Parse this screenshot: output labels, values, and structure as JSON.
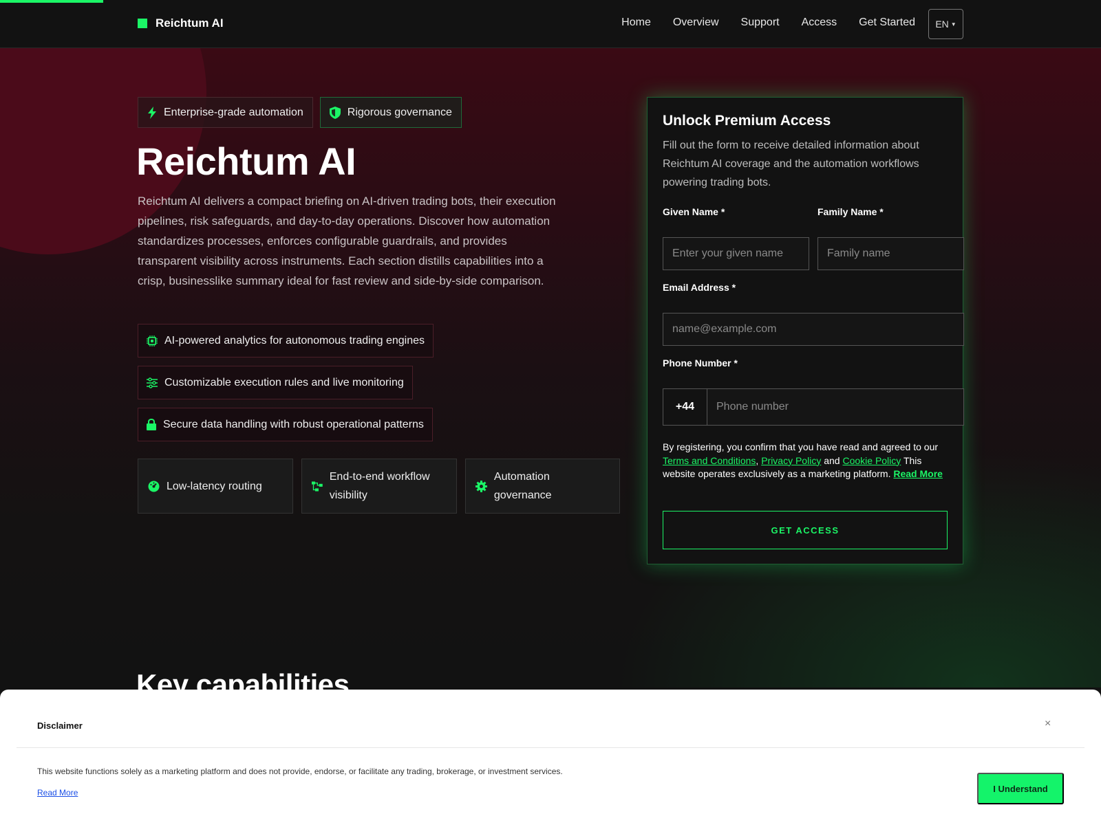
{
  "nav": {
    "brand": "Reichtum AI",
    "links": [
      "Home",
      "Overview",
      "Support",
      "Access",
      "Get Started"
    ],
    "language": "EN"
  },
  "hero": {
    "badges": [
      "Enterprise-grade automation",
      "Rigorous governance"
    ],
    "title": "Reichtum AI",
    "description": "Reichtum AI delivers a compact briefing on AI-driven trading bots, their execution pipelines, risk safeguards, and day-to-day operations. Discover how automation standardizes processes, enforces configurable guardrails, and provides transparent visibility across instruments. Each section distills capabilities into a crisp, businesslike summary ideal for fast review and side-by-side comparison.",
    "features": [
      {
        "label": "AI-powered analytics for autonomous trading engines",
        "icon": "chip-icon"
      },
      {
        "label": "Customizable execution rules and live monitoring",
        "icon": "sliders-icon"
      },
      {
        "label": "Secure data handling with robust operational patterns",
        "icon": "lock-icon"
      }
    ],
    "cards": [
      {
        "label": "Low-latency routing",
        "icon": "gauge-icon"
      },
      {
        "label": "End-to-end workflow visibility",
        "icon": "workflow-icon"
      },
      {
        "label": "Automation governance",
        "icon": "gear-icon"
      }
    ]
  },
  "form": {
    "title": "Unlock Premium Access",
    "subtitle": "Fill out the form to receive detailed information about Reichtum AI coverage and the automation workflows powering trading bots.",
    "given_name_label": "Given Name *",
    "given_name_placeholder": "Enter your given name",
    "family_name_label": "Family Name *",
    "family_name_placeholder": "Family name",
    "email_label": "Email Address *",
    "email_placeholder": "name@example.com",
    "phone_label": "Phone Number *",
    "phone_code": "+44",
    "phone_placeholder": "Phone number",
    "terms_prefix": "By registering, you confirm that you have read and agreed to our",
    "terms_link": "Terms and Conditions",
    "privacy_link": "Privacy Policy",
    "and": "and",
    "cookie_link": "Cookie Policy",
    "terms_suffix": "This website operates exclusively as a marketing platform.",
    "read_more": "Read More",
    "submit_label": "GET ACCESS"
  },
  "section": {
    "heading": "Key capabilities"
  },
  "disclaimer": {
    "title": "Disclaimer",
    "close": "×",
    "text": "This website functions solely as a marketing platform and does not provide, endorse, or facilitate any trading, brokerage, or investment services.",
    "read_more": "Read More",
    "button": "I Understand"
  },
  "colors": {
    "accent": "#1bf566",
    "background": "#121212",
    "hero_maroon": "#4b0b1a"
  }
}
